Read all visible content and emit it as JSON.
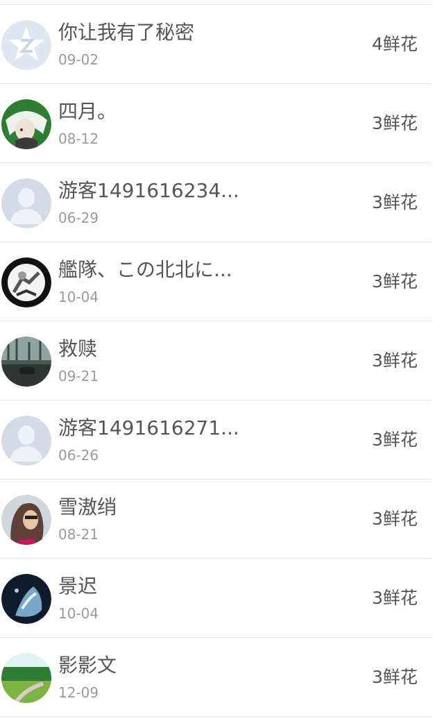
{
  "items": [
    {
      "name": "你让我有了秘密",
      "date": "09-02",
      "flowers": "4鲜花",
      "avatar": "qzone-star-icon"
    },
    {
      "name": "四月。",
      "date": "08-12",
      "flowers": "3鲜花",
      "avatar": "anime-portrait-avatar"
    },
    {
      "name": "游客1491616234...",
      "date": "06-29",
      "flowers": "3鲜花",
      "avatar": "default-user-silhouette"
    },
    {
      "name": "艦隊、この北北に...",
      "date": "10-04",
      "flowers": "3鲜花",
      "avatar": "dark-ring-avatar"
    },
    {
      "name": "救赎",
      "date": "09-21",
      "flowers": "3鲜花",
      "avatar": "city-street-avatar"
    },
    {
      "name": "游客1491616271...",
      "date": "06-26",
      "flowers": "3鲜花",
      "avatar": "default-user-silhouette"
    },
    {
      "name": "雪滶绡",
      "date": "08-21",
      "flowers": "3鲜花",
      "avatar": "girl-photo-avatar"
    },
    {
      "name": "景迟",
      "date": "10-04",
      "flowers": "3鲜花",
      "avatar": "blue-splash-avatar"
    },
    {
      "name": "影影文",
      "date": "12-09",
      "flowers": "3鲜花",
      "avatar": "green-landscape-avatar"
    }
  ]
}
